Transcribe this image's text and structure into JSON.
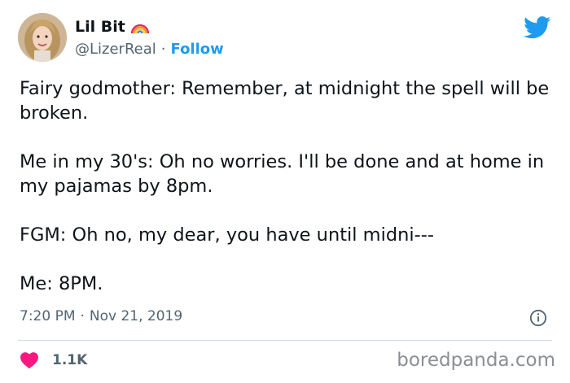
{
  "user": {
    "display_name": "Lil Bit",
    "badge_icon": "rainbow-icon",
    "handle": "@LizerReal",
    "separator": "·",
    "follow_label": "Follow"
  },
  "tweet": {
    "paragraphs": [
      "Fairy godmother: Remember, at midnight the spell will be broken.",
      "Me in my 30's: Oh no worries. I'll be done and at home in my pajamas by 8pm.",
      "FGM: Oh no, my dear, you have until midni---",
      "Me: 8PM."
    ],
    "time": "7:20 PM",
    "date_separator": "·",
    "date": "Nov 21, 2019"
  },
  "engagement": {
    "like_count": "1.1K",
    "like_icon": "heart-icon"
  },
  "watermark": {
    "text": "boredpanda.com"
  },
  "colors": {
    "accent": "#1d9bf0",
    "heart": "#f91880",
    "secondary_text": "#536471",
    "primary_text": "#0f1419"
  }
}
